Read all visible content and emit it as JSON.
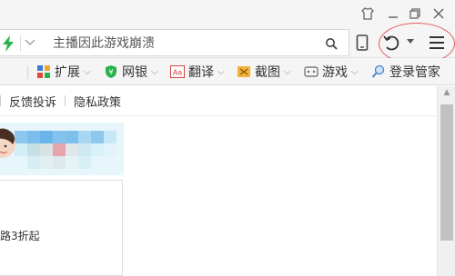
{
  "window": {
    "skin_icon": "shirt-icon",
    "minimize_icon": "minimize-icon",
    "restore_icon": "restore-icon",
    "close_icon": "close-icon"
  },
  "address_bar": {
    "lightning_icon": "lightning-icon",
    "dropdown_icon": "chevron-down-icon",
    "url_placeholder": "主播因此游戏崩溃",
    "search_icon": "search-icon",
    "mobile_icon": "mobile-icon",
    "undo_icon": "undo-icon",
    "menu_icon": "menu-icon"
  },
  "favorites_bar": {
    "items": [
      {
        "label": "扩展",
        "icon": "extensions-icon"
      },
      {
        "label": "网银",
        "icon": "bank-shield-icon"
      },
      {
        "label": "翻译",
        "icon": "translate-icon"
      },
      {
        "label": "截图",
        "icon": "screenshot-icon"
      },
      {
        "label": "游戏",
        "icon": "game-icon"
      },
      {
        "label": "登录管家",
        "icon": "login-search-icon"
      }
    ]
  },
  "page": {
    "links": [
      "反馈投诉",
      "隐私政策"
    ],
    "promo_text": "路3折起"
  },
  "colors": {
    "accent_green": "#29b34a",
    "highlight_red": "#e05a5a"
  }
}
